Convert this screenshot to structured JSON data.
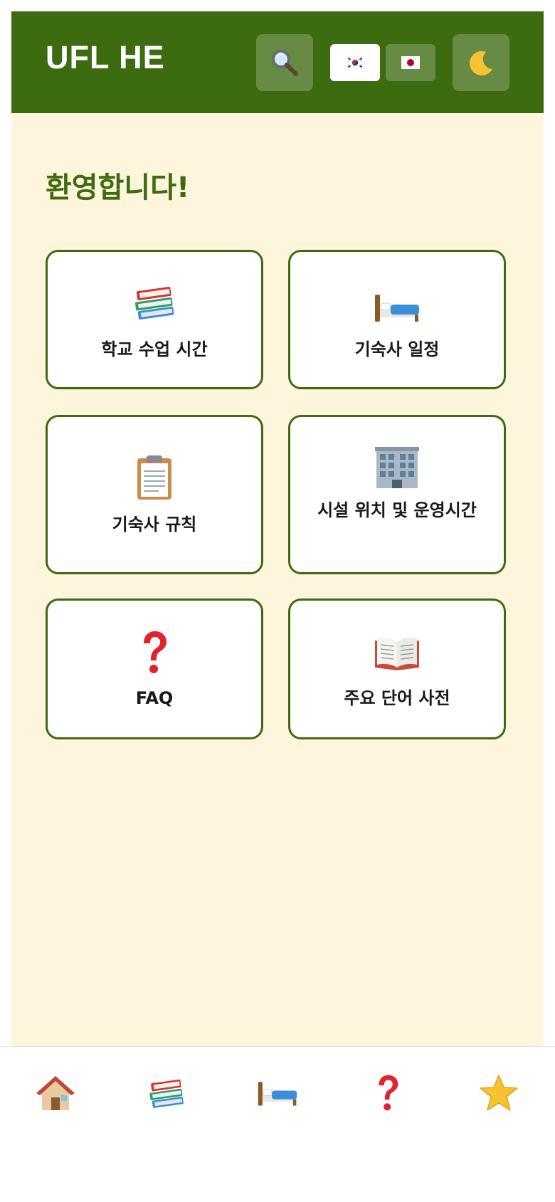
{
  "header": {
    "title": "UFL HE",
    "search_icon": "magnifier-icon",
    "theme_icon": "crescent-moon-icon",
    "languages": [
      {
        "code": "ko",
        "icon": "korea-flag-icon",
        "active": true
      },
      {
        "code": "ja",
        "icon": "japan-flag-icon",
        "active": false
      }
    ]
  },
  "main": {
    "welcome": "환영합니다!",
    "cards": [
      {
        "icon": "books-icon",
        "label": "학교 수업 시간"
      },
      {
        "icon": "bed-icon",
        "label": "기숙사 일정"
      },
      {
        "icon": "clipboard-icon",
        "label": "기숙사 규칙"
      },
      {
        "icon": "building-icon",
        "label": "시설 위치 및 운영시간"
      },
      {
        "icon": "question-mark-icon",
        "label": "FAQ"
      },
      {
        "icon": "open-book-icon",
        "label": "주요 단어 사전"
      }
    ]
  },
  "bottom_nav": {
    "items": [
      {
        "icon": "house-icon"
      },
      {
        "icon": "books-icon"
      },
      {
        "icon": "bed-icon"
      },
      {
        "icon": "question-mark-icon"
      },
      {
        "icon": "star-icon"
      }
    ]
  },
  "colors": {
    "header_bg": "#3d6b10",
    "page_bg": "#fdf6dc",
    "accent": "#3d6b10",
    "card_bg": "#ffffff"
  }
}
